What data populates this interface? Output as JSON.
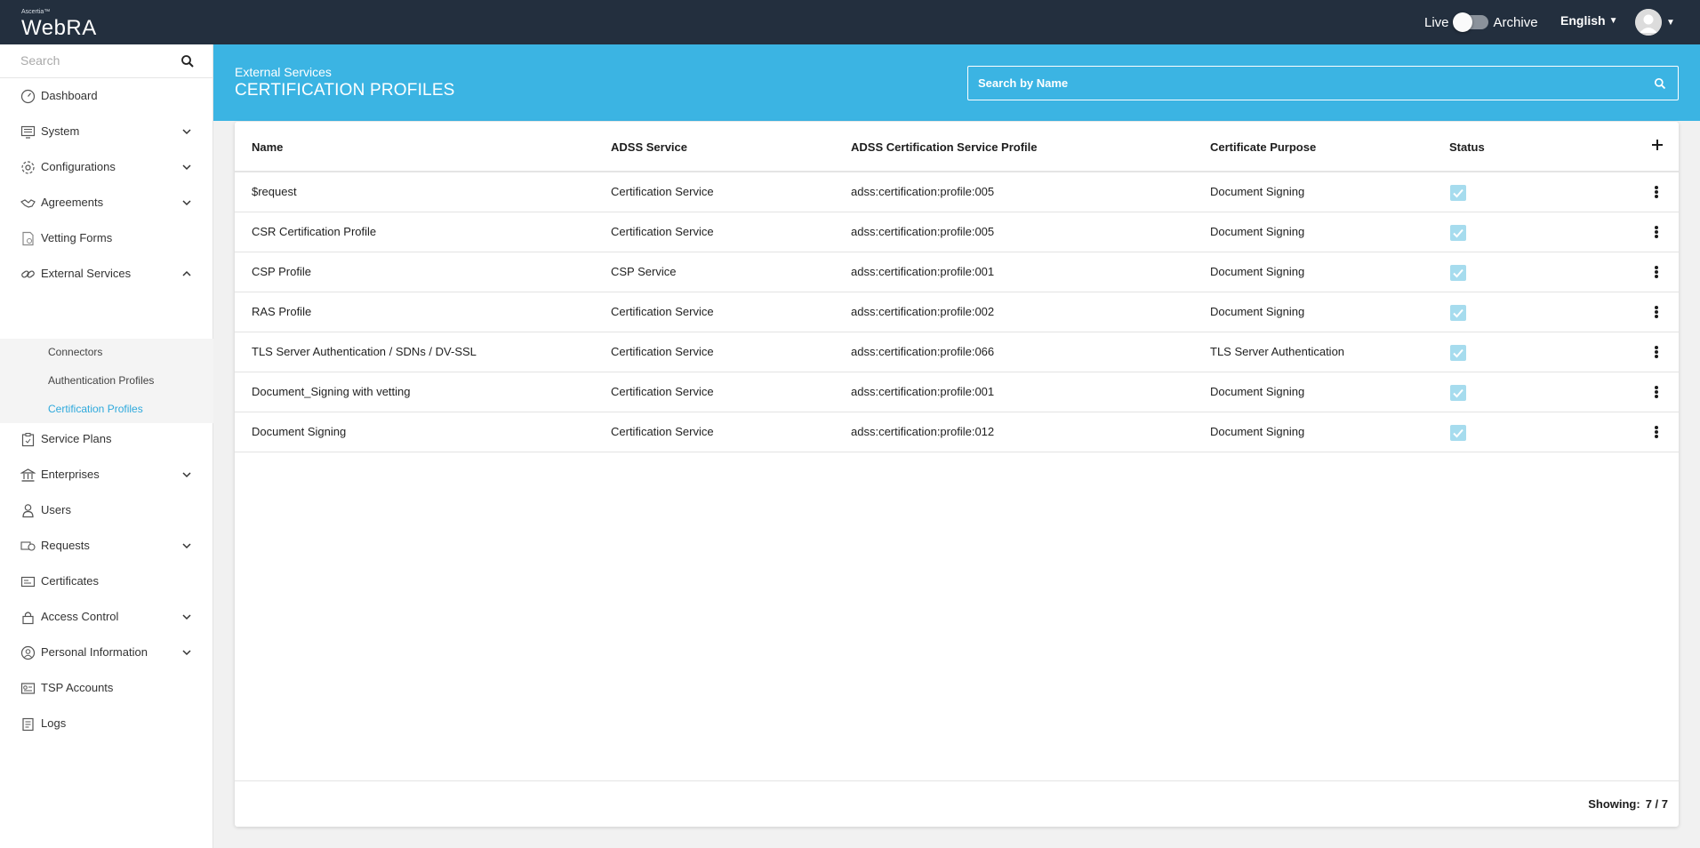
{
  "app": {
    "logo_tm": "Ascertia™",
    "logo_text": "WebRA",
    "mode_live": "Live",
    "mode_archive": "Archive",
    "language": "English"
  },
  "sidebar": {
    "search_placeholder": "Search",
    "items": [
      {
        "label": "Dashboard",
        "icon": "dashboard-icon"
      },
      {
        "label": "System",
        "icon": "system-icon",
        "expandable": true
      },
      {
        "label": "Configurations",
        "icon": "gear-icon",
        "expandable": true
      },
      {
        "label": "Agreements",
        "icon": "handshake-icon",
        "expandable": true
      },
      {
        "label": "Vetting Forms",
        "icon": "form-icon"
      },
      {
        "label": "External Services",
        "icon": "link-icon",
        "expandable": true,
        "expanded": true
      },
      {
        "label": "Service Plans",
        "icon": "plan-icon"
      },
      {
        "label": "Enterprises",
        "icon": "bank-icon",
        "expandable": true
      },
      {
        "label": "Users",
        "icon": "user-icon"
      },
      {
        "label": "Requests",
        "icon": "requests-icon",
        "expandable": true
      },
      {
        "label": "Certificates",
        "icon": "certificate-icon"
      },
      {
        "label": "Access Control",
        "icon": "lock-icon",
        "expandable": true
      },
      {
        "label": "Personal Information",
        "icon": "person-circle-icon",
        "expandable": true
      },
      {
        "label": "TSP Accounts",
        "icon": "id-card-icon"
      },
      {
        "label": "Logs",
        "icon": "logs-icon"
      }
    ],
    "sub_items": [
      {
        "label": "Connectors"
      },
      {
        "label": "Authentication Profiles"
      },
      {
        "label": "Certification Profiles",
        "active": true
      }
    ]
  },
  "header": {
    "breadcrumb": "External Services",
    "title": "CERTIFICATION PROFILES",
    "search_placeholder": "Search by Name"
  },
  "table": {
    "columns": [
      "Name",
      "ADSS Service",
      "ADSS Certification Service Profile",
      "Certificate Purpose",
      "Status"
    ],
    "rows": [
      {
        "name": "$request",
        "service": "Certification Service",
        "profile": "adss:certification:profile:005",
        "purpose": "Document Signing",
        "status": true
      },
      {
        "name": "CSR Certification Profile",
        "service": "Certification Service",
        "profile": "adss:certification:profile:005",
        "purpose": "Document Signing",
        "status": true
      },
      {
        "name": "CSP Profile",
        "service": "CSP Service",
        "profile": "adss:certification:profile:001",
        "purpose": "Document Signing",
        "status": true
      },
      {
        "name": "RAS Profile",
        "service": "Certification Service",
        "profile": "adss:certification:profile:002",
        "purpose": "Document Signing",
        "status": true
      },
      {
        "name": "TLS Server Authentication / SDNs / DV-SSL",
        "service": "Certification Service",
        "profile": "adss:certification:profile:066",
        "purpose": "TLS Server Authentication",
        "status": true
      },
      {
        "name": "Document_Signing with vetting",
        "service": "Certification Service",
        "profile": "adss:certification:profile:001",
        "purpose": "Document Signing",
        "status": true
      },
      {
        "name": "Document Signing",
        "service": "Certification Service",
        "profile": "adss:certification:profile:012",
        "purpose": "Document Signing",
        "status": true
      }
    ]
  },
  "footer": {
    "showing_label": "Showing:",
    "showing_value": "7 / 7"
  },
  "colors": {
    "topbar": "#232f3e",
    "banner": "#3bb4e3",
    "active_link": "#2ea9dc",
    "checkbox": "#a6dcee"
  }
}
